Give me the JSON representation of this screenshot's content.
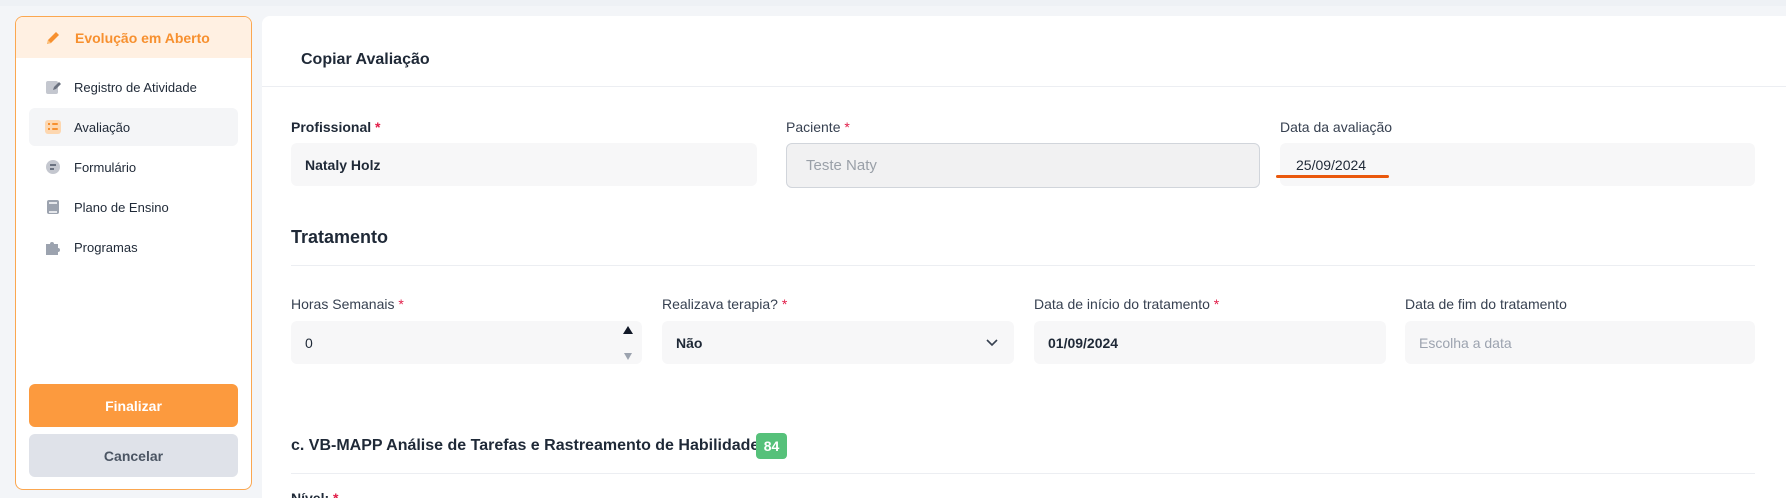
{
  "sidebar": {
    "header": "Evolução em Aberto",
    "items": [
      {
        "label": "Registro de Atividade",
        "icon": "document-edit-icon"
      },
      {
        "label": "Avaliação",
        "icon": "checklist-icon"
      },
      {
        "label": "Formulário",
        "icon": "form-icon"
      },
      {
        "label": "Plano de Ensino",
        "icon": "book-icon"
      },
      {
        "label": "Programas",
        "icon": "puzzle-icon"
      }
    ],
    "finalize_label": "Finalizar",
    "cancel_label": "Cancelar"
  },
  "card": {
    "title": "Copiar Avaliação",
    "profissional": {
      "label": "Profissional",
      "value": "Nataly Holz"
    },
    "paciente": {
      "label": "Paciente",
      "value": "Teste Naty"
    },
    "data_avaliacao": {
      "label": "Data da avaliação",
      "value": "25/09/2024"
    }
  },
  "tratamento": {
    "title": "Tratamento",
    "horas": {
      "label": "Horas Semanais",
      "value": "0"
    },
    "terapia": {
      "label": "Realizava terapia?",
      "value": "Não"
    },
    "inicio": {
      "label": "Data de início do tratamento",
      "value": "01/09/2024"
    },
    "fim": {
      "label": "Data de fim do tratamento",
      "placeholder": "Escolha a data"
    }
  },
  "vbmapp": {
    "title": "c. VB-MAPP Análise de Tarefas e Rastreamento de Habilidades",
    "badge": "84",
    "nivel_label": "Nível:"
  },
  "required_marker": "*",
  "colors": {
    "accent": "#f7902f",
    "accent_bg": "#fff0e2",
    "finalize": "#fc9a3e",
    "badge": "#56c17a",
    "required": "#e11d48"
  }
}
